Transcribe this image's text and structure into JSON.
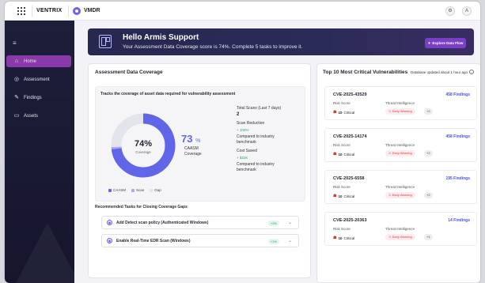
{
  "topbar": {
    "logo": "VENTRIX",
    "app_name": "VMDR",
    "right_icon": "settings-icon",
    "avatar": "A"
  },
  "sidebar": {
    "menu_icon": "menu-icon",
    "items": [
      {
        "label": "Home",
        "icon": "home-icon",
        "active": true
      },
      {
        "label": "Assessment",
        "icon": "assessment-icon",
        "active": false
      },
      {
        "label": "Findings",
        "icon": "findings-icon",
        "active": false
      },
      {
        "label": "Assets",
        "icon": "assets-icon",
        "active": false
      }
    ]
  },
  "banner": {
    "title": "Hello Armis Support",
    "subtitle": "Your Assessment Data Coverage score is 74%. Complete 5 tasks to improve it.",
    "button": "Explore Data Flow"
  },
  "coverage": {
    "title": "Assessment Data Coverage",
    "inner_title": "Tracks the coverage of asset data required for vulnerability assessment",
    "donut_pct": "74%",
    "donut_label": "Coverage",
    "caasm_pct": "73",
    "caasm_unit": "%",
    "caasm_label_1": "CAASM",
    "caasm_label_2": "Coverage",
    "donut_value": 74,
    "legend": [
      "CAASM",
      "Scan",
      "Gap"
    ],
    "colors": {
      "caasm": "#6066e8",
      "scan": "#a9a8f2",
      "gap": "#e4e4ec"
    },
    "stats": {
      "total_scans_label": "Total Scans (Last 7 days)",
      "total_scans_value": "2",
      "scan_reduction_label": "Scan Reduction",
      "scan_reduction_value": "+ 100%",
      "scan_reduction_note_1": "Compared to industry",
      "scan_reduction_note_2": "benchmark",
      "cost_saved_label": "Cost Saved",
      "cost_saved_value": "+ $32K",
      "cost_saved_note_1": "Compared to industry",
      "cost_saved_note_2": "benchmark"
    },
    "rec_title": "Recommended Tasks for Closing Coverage Gaps",
    "tasks": [
      {
        "label": "Add Detect scan policy (Authenticated Windows)",
        "pct": "+3%"
      },
      {
        "label": "Enable Real-Time EDR Scan (Windows)",
        "pct": "+1%"
      }
    ]
  },
  "vulns": {
    "title": "Top 10 Most Critical Vulnerabilities",
    "updated": "Database updated about 1 hour ago",
    "risk_label": "Risk Score",
    "ti_label": "Threat Intelligence",
    "cards": [
      {
        "cve": "CVE-2025-43529",
        "findings": "458 Findings",
        "risk": "10",
        "severity": "Critical",
        "ti": "Early Warning",
        "more": "+2"
      },
      {
        "cve": "CVE-2025-14174",
        "findings": "458 Findings",
        "risk": "10",
        "severity": "Critical",
        "ti": "Early Warning",
        "more": "+2"
      },
      {
        "cve": "CVE-2025-6558",
        "findings": "195 Findings",
        "risk": "10",
        "severity": "Critical",
        "ti": "Early Warning",
        "more": "+2"
      },
      {
        "cve": "CVE-2025-20363",
        "findings": "14 Findings",
        "risk": "10",
        "severity": "Critical",
        "ti": "Early Warning",
        "more": "+1"
      }
    ]
  }
}
